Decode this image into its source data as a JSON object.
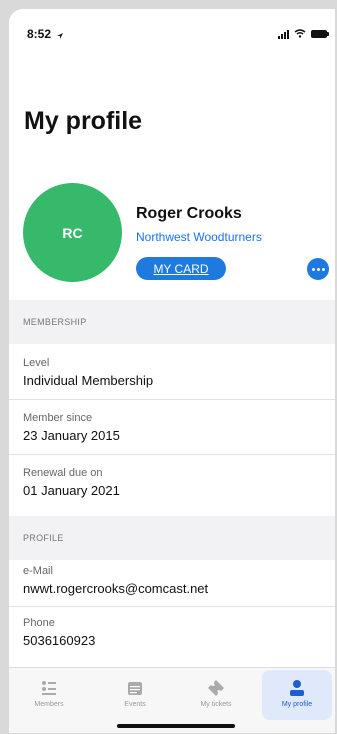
{
  "status_bar": {
    "time": "8:52"
  },
  "header": {
    "title": "My profile"
  },
  "profile": {
    "initials": "RC",
    "name": "Roger Crooks",
    "organization": "Northwest Woodturners",
    "card_button_label": "MY CARD",
    "avatar_color": "#37b96b",
    "accent_color": "#1f7ae0"
  },
  "membership": {
    "section_title": "MEMBERSHIP",
    "level_label": "Level",
    "level_value": "Individual Membership",
    "since_label": "Member since",
    "since_value": "23 January 2015",
    "renewal_label": "Renewal due on",
    "renewal_value": "01 January 2021"
  },
  "profile_section": {
    "section_title": "PROFILE",
    "email_label": "e-Mail",
    "email_value": "nwwt.rogercrooks@comcast.net",
    "phone_label": "Phone",
    "phone_value": "5036160923"
  },
  "tabs": [
    {
      "label": "Members",
      "icon": "members-list-icon",
      "active": false
    },
    {
      "label": "Events",
      "icon": "calendar-icon",
      "active": false
    },
    {
      "label": "My tickets",
      "icon": "ticket-icon",
      "active": false
    },
    {
      "label": "My profile",
      "icon": "person-icon",
      "active": true
    }
  ]
}
